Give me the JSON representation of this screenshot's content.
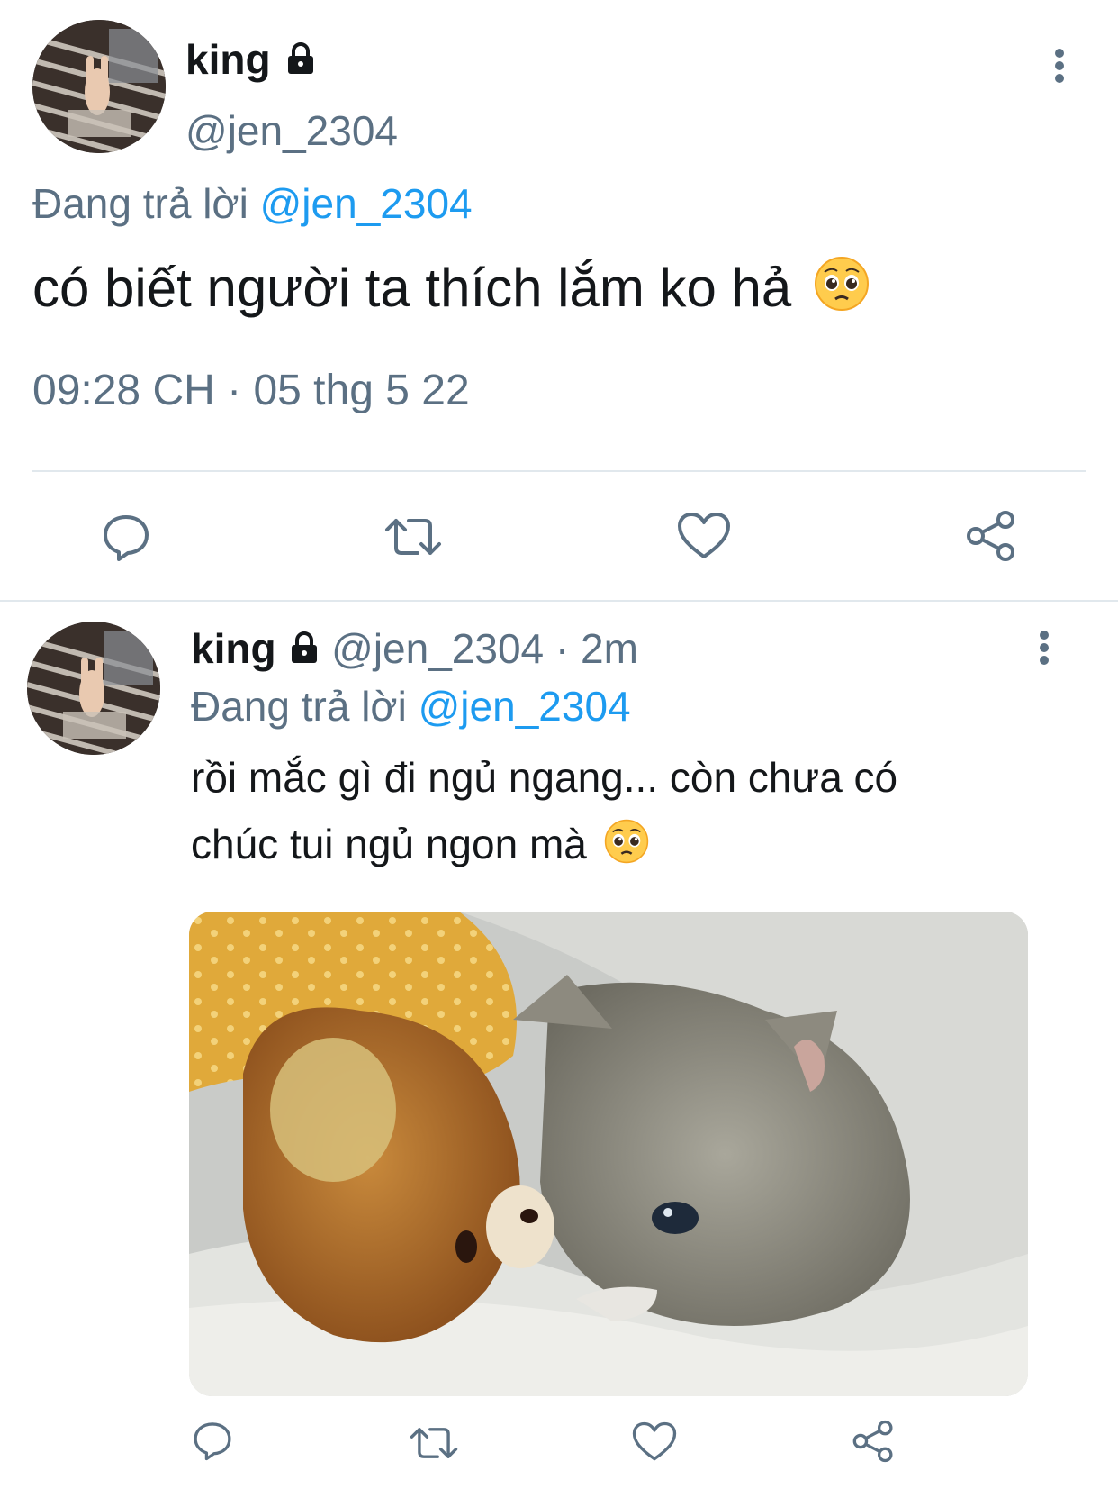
{
  "main_tweet": {
    "display_name": "king",
    "handle": "@jen_2304",
    "reply_prefix": "Đang trả lời",
    "reply_to": "@jen_2304",
    "text": "có biết người ta thích lắm ko hả",
    "emoji": "pleading-face-emoji",
    "timestamp": "09:28 CH · 05 thg 5 22",
    "actions": [
      "reply-icon",
      "retweet-icon",
      "like-icon",
      "share-icon"
    ]
  },
  "reply_tweet": {
    "display_name": "king",
    "handle": "@jen_2304",
    "time": "· 2m",
    "reply_prefix": "Đang trả lời",
    "reply_to": "@jen_2304",
    "text_line1": "rồi mắc gì đi ngủ ngang... còn chưa có",
    "text_line2": "chúc tui ngủ ngon mà",
    "emoji": "pleading-face-emoji",
    "media": "crying-kitten-with-teddy-bear-photo",
    "actions": [
      "reply-icon",
      "retweet-icon",
      "like-icon",
      "share-icon"
    ]
  },
  "colors": {
    "text": "#14171a",
    "secondary": "#5b7083",
    "link": "#1d9bf0",
    "divider": "#e1e8ed"
  }
}
